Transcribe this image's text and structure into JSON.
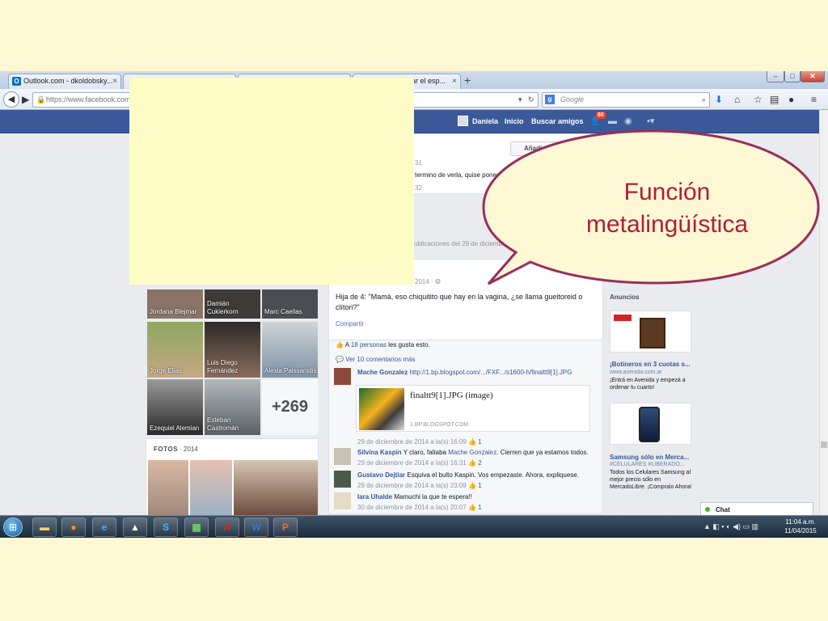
{
  "browser": {
    "tabs": [
      {
        "label": "Outlook.com - dkoldobsky..."
      },
      {
        "label": "lar el esp..."
      }
    ],
    "new_tab": "+",
    "url": "https://www.facebook.com/s",
    "search_placeholder": "Google",
    "search_engine": "g"
  },
  "facebook": {
    "nav": {
      "user": "Daniela",
      "home": "Inicio",
      "find_friends": "Buscar amigos",
      "notif_count": "60"
    },
    "add_friend": "Añadir",
    "friends": [
      {
        "name": "Jordana Blejmar"
      },
      {
        "name": "Damián Cukierkorn"
      },
      {
        "name": "Marc Caellas"
      },
      {
        "name": "Jorge Elías"
      },
      {
        "name": "Luis Diego Fernández"
      },
      {
        "name": "Alexia Paissanidis"
      },
      {
        "name": "Ezequiel Alemian"
      },
      {
        "name": "Esteban Castromán"
      }
    ],
    "more_friends": "+269",
    "fotos": {
      "label": "FOTOS",
      "year": "2014"
    },
    "prev_post": {
      "time1": "31",
      "text": "termino de verla, quise poner",
      "time2": "32",
      "group_label": "ublicaciones del 29 de diciembre"
    },
    "post": {
      "date": "2014 ·",
      "text": "Hija de 4: \"Mamá, eso chiquitito que hay en la vagina, ¿se llama gueitoreid o clítori?\"",
      "share": "Compartir",
      "likes_prefix": "A",
      "likes_count": "18 personas",
      "likes_suffix": "les gusta esto.",
      "view_comments": "Ver 10 comentarios más"
    },
    "comments": [
      {
        "name": "Mache Gonzalez",
        "text": "http://1.bp.blogspot.com/.../FXF.../s1600-h/finaltt9[1].JPG",
        "time": "29 de diciembre de 2014 a la(s) 16:09",
        "likes": "1"
      },
      {
        "name": "Silvina Kaspin",
        "text": "Y claro, faltaba",
        "mention": "Mache Gonzalez",
        "text2": ". Cierren que ya estamos todos.",
        "time": "29 de diciembre de 2014 a la(s) 16:31",
        "likes": "2"
      },
      {
        "name": "Gustavo Dejtiar",
        "text": "Esquiva el bulto Kaspin. Vos empezaste. Ahora, expliquese.",
        "time": "29 de diciembre de 2014 a la(s) 23:09",
        "likes": "1"
      },
      {
        "name": "Iara Uhalde",
        "text": "Mamuchi la que te espera!!",
        "time": "30 de diciembre de 2014 a la(s) 20:07",
        "likes": "1"
      }
    ],
    "link_preview": {
      "title": "finaltt9[1].JPG (image)",
      "domain": "1.BP.BLOGSPOT.COM"
    },
    "ads": {
      "header": "Anuncios",
      "items": [
        {
          "title": "¡Botineros en 3 cuotas s...",
          "url": "www.avenida.com.ar",
          "text": "¡Entrá en Avenida y empezá a ordenar tu cuarto!"
        },
        {
          "title": "Samsung sólo en Merca...",
          "url": "#CELULARES #LIBERADO...",
          "text": "Todos los Celulares Samsung al mejor precio sólo en MercadoLibre. ¡Compralo Ahora!"
        }
      ]
    },
    "chat": "Chat"
  },
  "taskbar": {
    "clock_time": "11:04 a.m.",
    "clock_date": "11/04/2015"
  },
  "annotation": {
    "line1": "Función",
    "line2": "metalingüística"
  },
  "colors": {
    "facebook_blue": "#3b5998",
    "bubble_border": "#9a2d5c",
    "bubble_fill": "#fef9d4",
    "annotation_text": "#b21d36",
    "slide_background": "#fef9d4"
  }
}
